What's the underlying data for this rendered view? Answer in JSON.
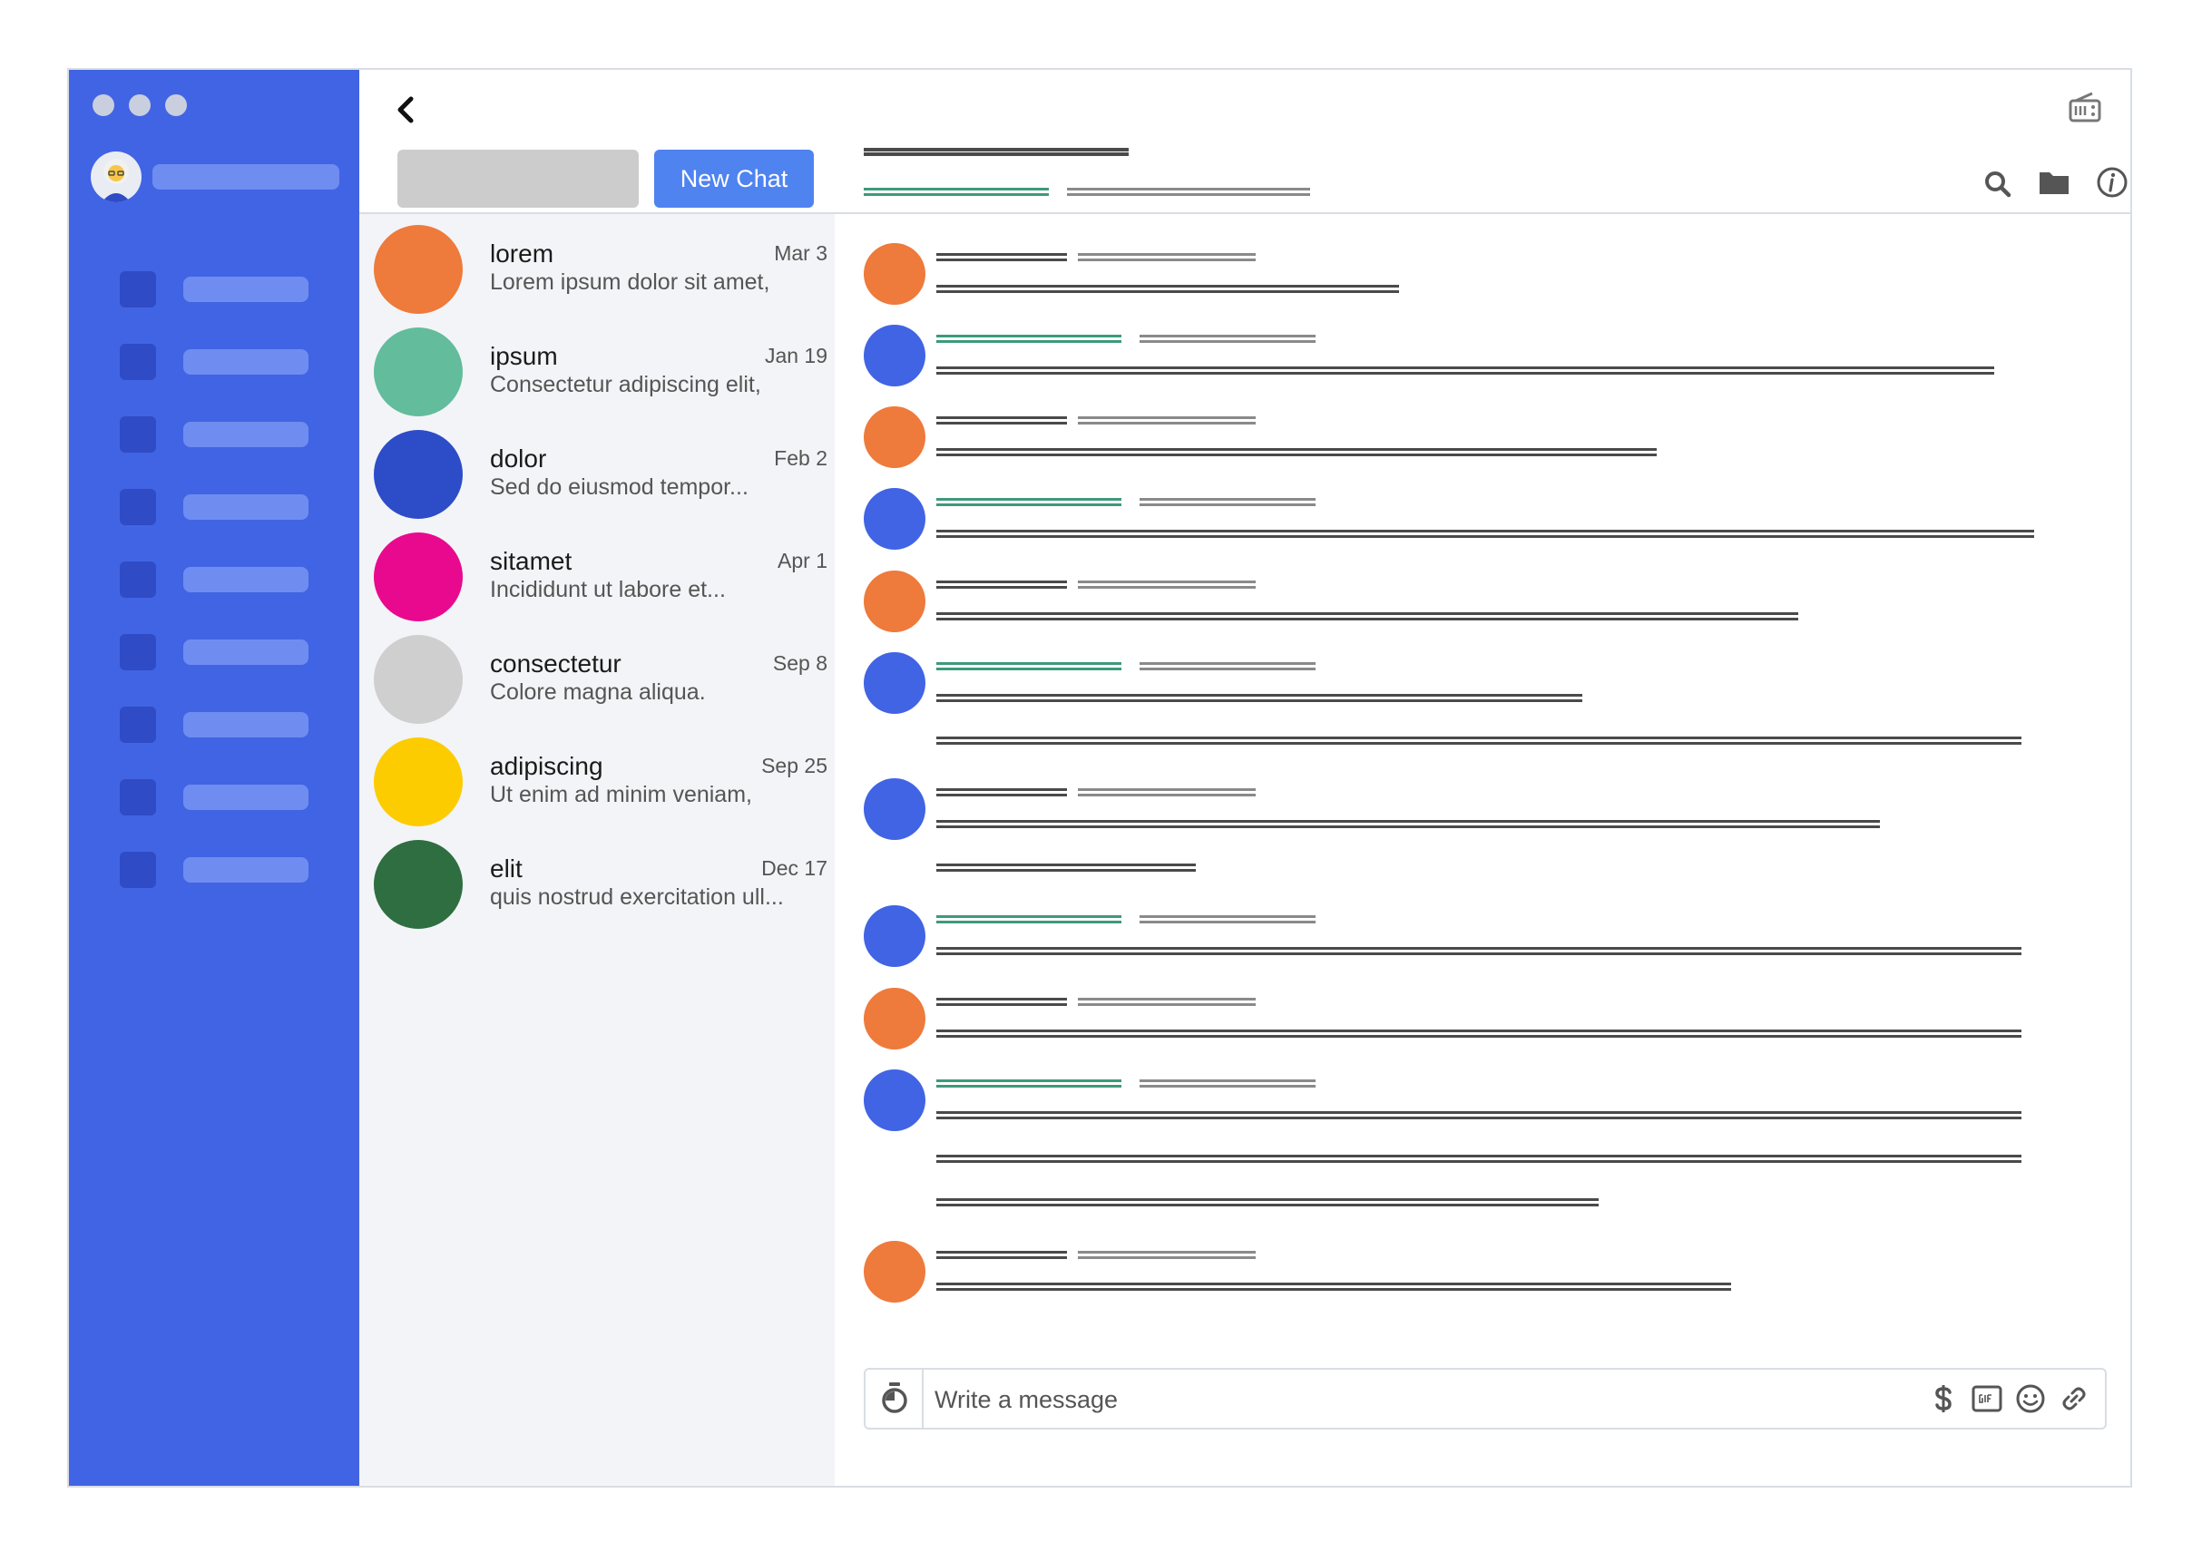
{
  "toolbar": {
    "new_chat_label": "New Chat"
  },
  "chats": [
    {
      "name": "lorem",
      "date": "Mar 3",
      "preview": "Lorem ipsum dolor sit amet,",
      "color": "#ee7a3b"
    },
    {
      "name": "ipsum",
      "date": "Jan 19",
      "preview": "Consectetur adipiscing elit,",
      "color": "#63bc9c"
    },
    {
      "name": "dolor",
      "date": "Feb 2",
      "preview": "Sed do eiusmod tempor...",
      "color": "#2d4cc8"
    },
    {
      "name": "sitamet",
      "date": "Apr 1",
      "preview": "Incididunt ut labore et...",
      "color": "#e8098e"
    },
    {
      "name": "consectetur",
      "date": "Sep 8",
      "preview": "Colore magna aliqua.",
      "color": "#cfcfcf"
    },
    {
      "name": "adipiscing",
      "date": "Sep 25",
      "preview": "Ut enim ad minim veniam,",
      "color": "#fccc00"
    },
    {
      "name": "elit",
      "date": "Dec 17",
      "preview": "quis nostrud exercitation ull...",
      "color": "#2e6e41"
    }
  ],
  "composer": {
    "placeholder": "Write a message"
  },
  "colors": {
    "sidebar": "#4164e4",
    "accent": "#4f83f0",
    "avatar_orange": "#ee7a3b",
    "avatar_blue": "#4164e4",
    "green_line": "#3d9a7a"
  },
  "icons": [
    "chevron-left-icon",
    "radio-icon",
    "search-icon",
    "folder-icon",
    "info-icon",
    "timer-icon",
    "dollar-icon",
    "gif-icon",
    "smiley-icon",
    "link-icon"
  ]
}
